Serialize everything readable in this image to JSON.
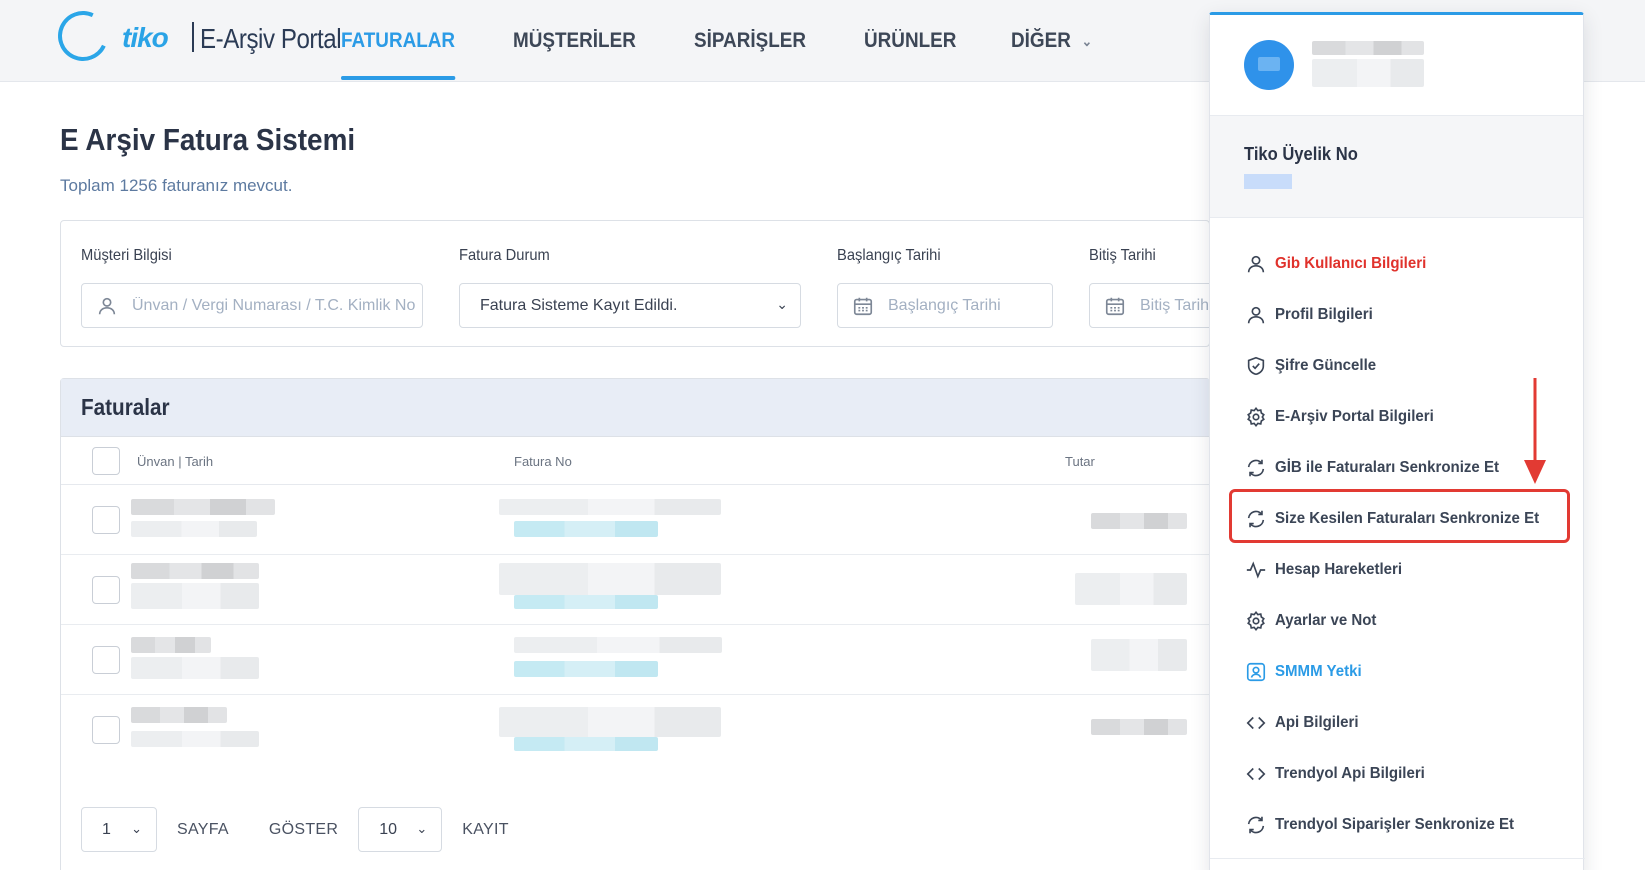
{
  "header": {
    "logo_tiko": "tiko",
    "logo_portal": "E-Arşiv Portal",
    "nav": [
      {
        "label": "FATURALAR",
        "active": true
      },
      {
        "label": "MÜŞTERİLER",
        "active": false
      },
      {
        "label": "SİPARİŞLER",
        "active": false
      },
      {
        "label": "ÜRÜNLER",
        "active": false
      },
      {
        "label": "DİĞER",
        "active": false
      }
    ]
  },
  "page": {
    "title": "E Arşiv Fatura Sistemi",
    "subtitle": "Toplam 1256 faturanız mevcut."
  },
  "filters": {
    "customer_label": "Müşteri Bilgisi",
    "customer_placeholder": "Ünvan / Vergi Numarası / T.C. Kimlik No",
    "status_label": "Fatura Durum",
    "status_value": "Fatura Sisteme Kayıt Edildi.",
    "start_label": "Başlangıç Tarihi",
    "start_placeholder": "Başlangıç Tarihi",
    "end_label": "Bitiş Tarihi",
    "end_placeholder": "Bitiş Tarihi"
  },
  "invoices": {
    "title": "Faturalar",
    "columns": [
      "Ünvan | Tarih",
      "Fatura No",
      "Tutar"
    ],
    "row_count": 4
  },
  "pager": {
    "page_value": "1",
    "page_label": "SAYFA",
    "show_label": "GÖSTER",
    "size_value": "10",
    "records_label": "KAYIT"
  },
  "profile_panel": {
    "member_label": "Tiko Üyelik No",
    "menu": [
      {
        "label": "Gib Kullanıcı Bilgileri",
        "icon": "user-icon",
        "style": "red"
      },
      {
        "label": "Profil Bilgileri",
        "icon": "user-icon",
        "style": "normal"
      },
      {
        "label": "Şifre Güncelle",
        "icon": "shield-check-icon",
        "style": "normal"
      },
      {
        "label": "E-Arşiv Portal Bilgileri",
        "icon": "gear-icon",
        "style": "normal"
      },
      {
        "label": "GİB ile Faturaları Senkronize Et",
        "icon": "sync-icon",
        "style": "normal"
      },
      {
        "label": "Size Kesilen Faturaları Senkronize Et",
        "icon": "sync-icon",
        "style": "normal"
      },
      {
        "label": "Hesap Hareketleri",
        "icon": "activity-icon",
        "style": "normal"
      },
      {
        "label": "Ayarlar ve Not",
        "icon": "settings-icon",
        "style": "normal"
      },
      {
        "label": "SMMM Yetki",
        "icon": "user-badge-icon",
        "style": "blue"
      },
      {
        "label": "Api Bilgileri",
        "icon": "code-icon",
        "style": "normal"
      },
      {
        "label": "Trendyol Api Bilgileri",
        "icon": "code-icon",
        "style": "normal"
      },
      {
        "label": "Trendyol Siparişler Senkronize Et",
        "icon": "sync-icon",
        "style": "normal"
      }
    ]
  },
  "colors": {
    "accent": "#2b9be6",
    "danger": "#e0322c",
    "annotation": "#e23a33"
  }
}
